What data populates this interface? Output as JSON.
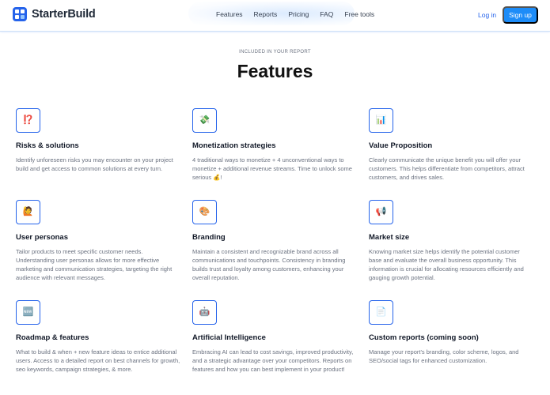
{
  "brand": {
    "name": "StarterBuild",
    "logo_icon": "grid-logo-icon"
  },
  "nav": {
    "links": [
      "Features",
      "Reports",
      "Pricing",
      "FAQ",
      "Free tools"
    ]
  },
  "auth": {
    "login": "Log in",
    "signup": "Sign up"
  },
  "colors": {
    "accent": "#1d8cf8",
    "brand": "#2563eb",
    "icon_border": "#2563eb"
  },
  "section": {
    "eyebrow": "INCLUDED IN YOUR REPORT",
    "title": "Features"
  },
  "features": [
    {
      "icon": "⁉️",
      "icon_name": "exclamation-question-icon",
      "title": "Risks & solutions",
      "desc": "Identify unforeseen risks you may encounter on your project build and get access to common solutions at every turn."
    },
    {
      "icon": "💸",
      "icon_name": "money-wings-icon",
      "title": "Monetization strategies",
      "desc": "4 traditional ways to monetize + 4 unconventional ways to monetize + additional revenue streams. Time to unlock some serious 💰!"
    },
    {
      "icon": "📊",
      "icon_name": "bar-chart-icon",
      "title": "Value Proposition",
      "desc": "Clearly communicate the unique benefit you will offer your  customers. This helps differentiate from competitors, attract customers, and drives sales."
    },
    {
      "icon": "🙋",
      "icon_name": "person-raising-hand-icon",
      "title": "User personas",
      "desc": "Tailor products to meet specific customer needs. Understanding user personas allows for more effective marketing and communication strategies, targeting the right audience with relevant messages."
    },
    {
      "icon": "🎨",
      "icon_name": "palette-icon",
      "title": "Branding",
      "desc": "Maintain a consistent and recognizable brand across all communications and touchpoints. Consistency in branding builds trust and loyalty among customers, enhancing your overall reputation."
    },
    {
      "icon": "📢",
      "icon_name": "megaphone-icon",
      "title": "Market size",
      "desc": "Knowing market size helps identify the potential customer base and evaluate the overall business opportunity. This information is crucial for allocating resources efficiently and gauging growth potential."
    },
    {
      "icon": "🆕",
      "icon_name": "new-badge-icon",
      "title": "Roadmap & features",
      "desc": "What to build & when + new feature ideas to entice additional users. Access to a detailed report on best channels for growth, seo keywords, campaign strategies, & more."
    },
    {
      "icon": "🤖",
      "icon_name": "robot-icon",
      "title": "Artificial Intelligence",
      "desc": "Embracing AI can lead to cost savings, improved productivity, and a strategic advantage over your competitors. Reports on features and how you can best implement in your product!"
    },
    {
      "icon": "📄",
      "icon_name": "document-icon",
      "title": "Custom reports (coming soon)",
      "desc": "Manage your report's branding, color scheme, logos, and SEO/social tags for enhanced customization."
    }
  ]
}
